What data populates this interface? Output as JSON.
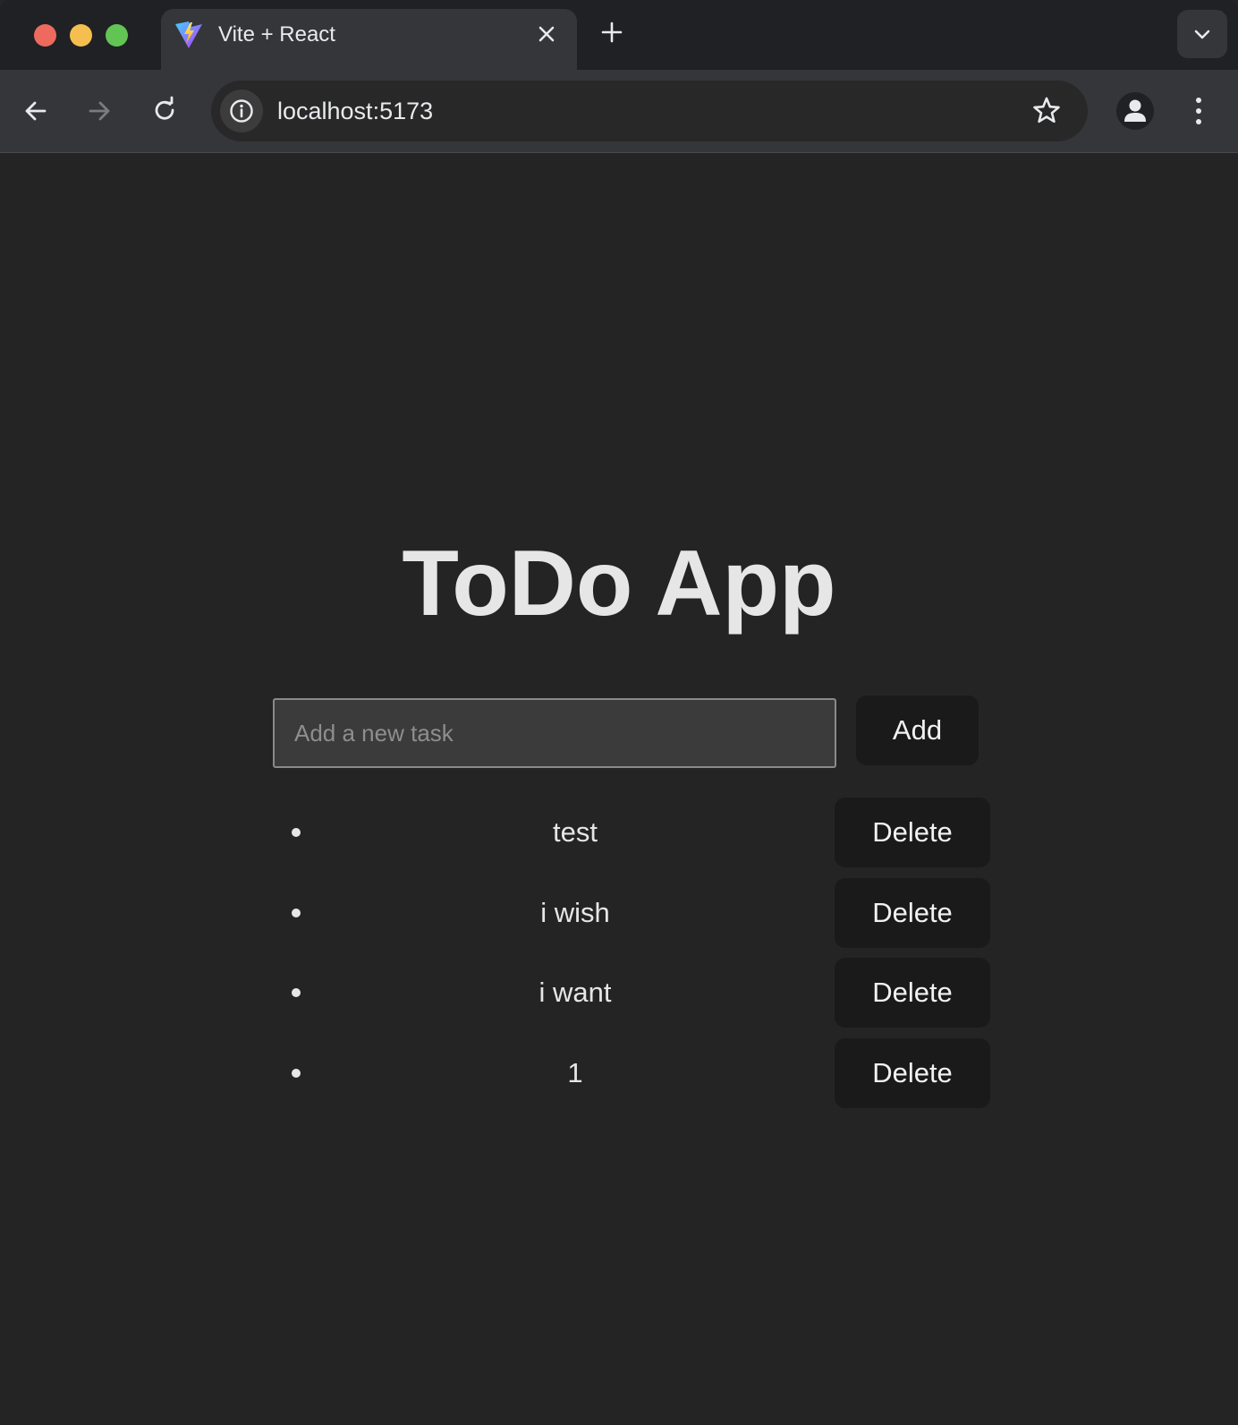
{
  "browser": {
    "tab_title": "Vite + React",
    "url": "localhost:5173"
  },
  "app": {
    "title": "ToDo App",
    "input_placeholder": "Add a new task",
    "input_value": "",
    "add_label": "Add",
    "tasks": [
      {
        "text": "test",
        "delete_label": "Delete"
      },
      {
        "text": "i wish",
        "delete_label": "Delete"
      },
      {
        "text": "i want",
        "delete_label": "Delete"
      },
      {
        "text": "1",
        "delete_label": "Delete"
      }
    ]
  },
  "icons": {
    "favicon": "vite-logo-icon",
    "back": "arrow-left-icon",
    "forward": "arrow-right-icon",
    "reload": "reload-icon",
    "site_info": "info-icon",
    "bookmark": "star-icon",
    "profile": "person-icon",
    "menu": "more-vert-icon",
    "tab_close": "close-icon",
    "new_tab": "plus-icon",
    "tab_search": "chevron-down-icon"
  }
}
